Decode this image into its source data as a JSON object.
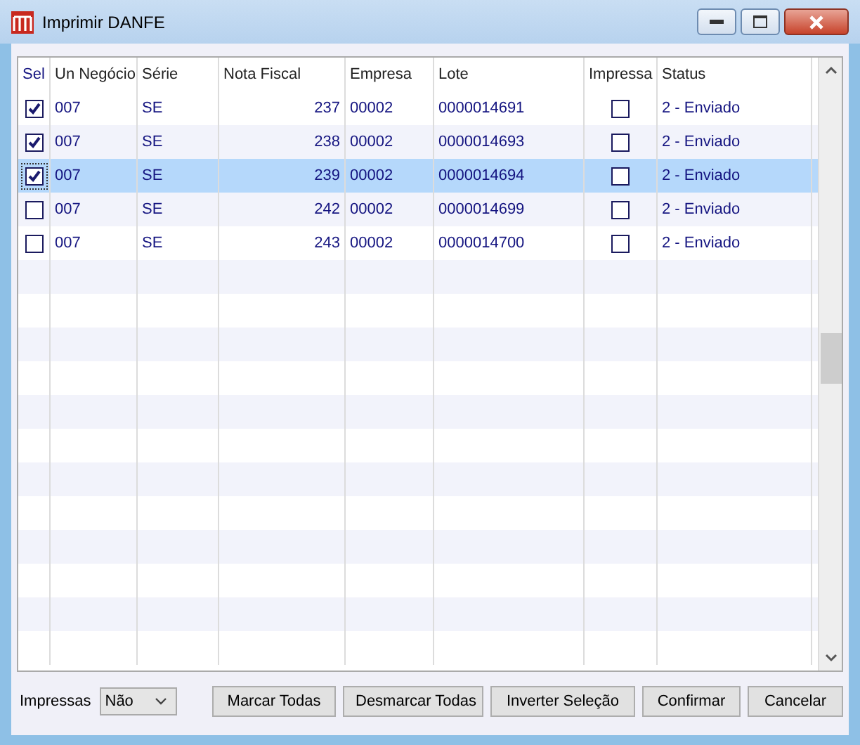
{
  "window": {
    "title": "Imprimir DANFE"
  },
  "table": {
    "columns": [
      "Sel",
      "Un Negócio",
      "Série",
      "Nota Fiscal",
      "Empresa",
      "Lote",
      "Impressa",
      "Status"
    ],
    "rows": [
      {
        "sel": true,
        "selected": false,
        "un_negocio": "007",
        "serie": "SE",
        "nota_fiscal": "237",
        "empresa": "00002",
        "lote": "0000014691",
        "impressa": false,
        "status": "2 - Enviado"
      },
      {
        "sel": true,
        "selected": false,
        "un_negocio": "007",
        "serie": "SE",
        "nota_fiscal": "238",
        "empresa": "00002",
        "lote": "0000014693",
        "impressa": false,
        "status": "2 - Enviado"
      },
      {
        "sel": true,
        "selected": true,
        "un_negocio": "007",
        "serie": "SE",
        "nota_fiscal": "239",
        "empresa": "00002",
        "lote": "0000014694",
        "impressa": false,
        "status": "2 - Enviado"
      },
      {
        "sel": false,
        "selected": false,
        "un_negocio": "007",
        "serie": "SE",
        "nota_fiscal": "242",
        "empresa": "00002",
        "lote": "0000014699",
        "impressa": false,
        "status": "2 - Enviado"
      },
      {
        "sel": false,
        "selected": false,
        "un_negocio": "007",
        "serie": "SE",
        "nota_fiscal": "243",
        "empresa": "00002",
        "lote": "0000014700",
        "impressa": false,
        "status": "2 - Enviado"
      }
    ]
  },
  "footer": {
    "filter_label": "Impressas",
    "filter_value": "Não",
    "buttons": [
      "Marcar Todas",
      "Desmarcar Todas",
      "Inverter Seleção",
      "Confirmar",
      "Cancelar"
    ]
  }
}
